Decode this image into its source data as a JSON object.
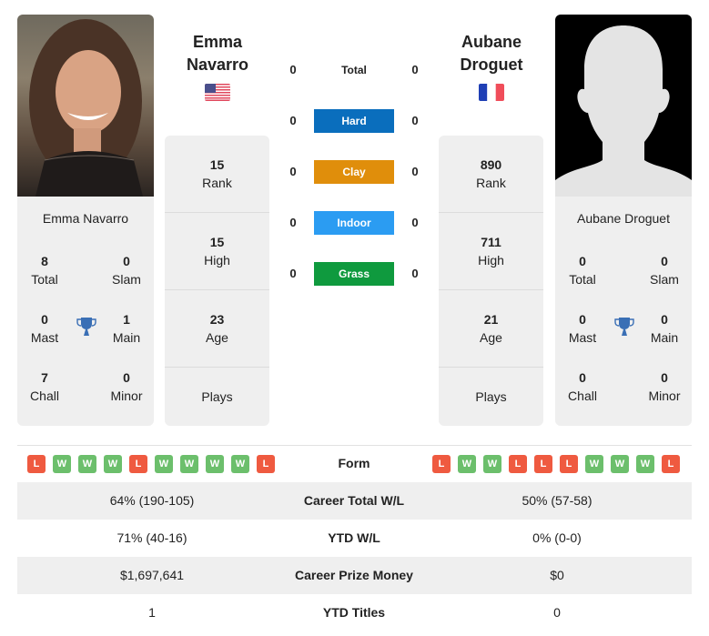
{
  "player_left": {
    "name_line1": "Emma",
    "name_line2": "Navarro",
    "full_name": "Emma Navarro",
    "country_flag": "flag-usa-icon",
    "rank": "15",
    "rank_label": "Rank",
    "high": "15",
    "high_label": "High",
    "age": "23",
    "age_label": "Age",
    "plays_label": "Plays",
    "titles": {
      "total": "8",
      "total_label": "Total",
      "slam": "0",
      "slam_label": "Slam",
      "mast": "0",
      "mast_label": "Mast",
      "main": "1",
      "main_label": "Main",
      "chall": "7",
      "chall_label": "Chall",
      "minor": "0",
      "minor_label": "Minor"
    },
    "form": [
      "L",
      "W",
      "W",
      "W",
      "L",
      "W",
      "W",
      "W",
      "W",
      "L"
    ]
  },
  "player_right": {
    "name_line1": "Aubane",
    "name_line2": "Droguet",
    "full_name": "Aubane Droguet",
    "country_flag": "flag-france-icon",
    "rank": "890",
    "rank_label": "Rank",
    "high": "711",
    "high_label": "High",
    "age": "21",
    "age_label": "Age",
    "plays_label": "Plays",
    "titles": {
      "total": "0",
      "total_label": "Total",
      "slam": "0",
      "slam_label": "Slam",
      "mast": "0",
      "mast_label": "Mast",
      "main": "0",
      "main_label": "Main",
      "chall": "0",
      "chall_label": "Chall",
      "minor": "0",
      "minor_label": "Minor"
    },
    "form": [
      "L",
      "W",
      "W",
      "L",
      "L",
      "L",
      "W",
      "W",
      "W",
      "L"
    ]
  },
  "h2h": [
    {
      "label": "Total",
      "left": "0",
      "right": "0",
      "color": ""
    },
    {
      "label": "Hard",
      "left": "0",
      "right": "0",
      "color": "#0a6ebd"
    },
    {
      "label": "Clay",
      "left": "0",
      "right": "0",
      "color": "#e08e0b"
    },
    {
      "label": "Indoor",
      "left": "0",
      "right": "0",
      "color": "#2b9cf2"
    },
    {
      "label": "Grass",
      "left": "0",
      "right": "0",
      "color": "#0f9a3e"
    }
  ],
  "form_label": "Form",
  "stats": [
    {
      "label": "Career Total W/L",
      "left": "64% (190-105)",
      "right": "50% (57-58)"
    },
    {
      "label": "YTD W/L",
      "left": "71% (40-16)",
      "right": "0% (0-0)"
    },
    {
      "label": "Career Prize Money",
      "left": "$1,697,641",
      "right": "$0"
    },
    {
      "label": "YTD Titles",
      "left": "1",
      "right": "0"
    }
  ],
  "colors": {
    "win": "#6cbf6c",
    "loss": "#ef5a40",
    "trophy": "#3a6fb5",
    "panel": "#efefef"
  }
}
